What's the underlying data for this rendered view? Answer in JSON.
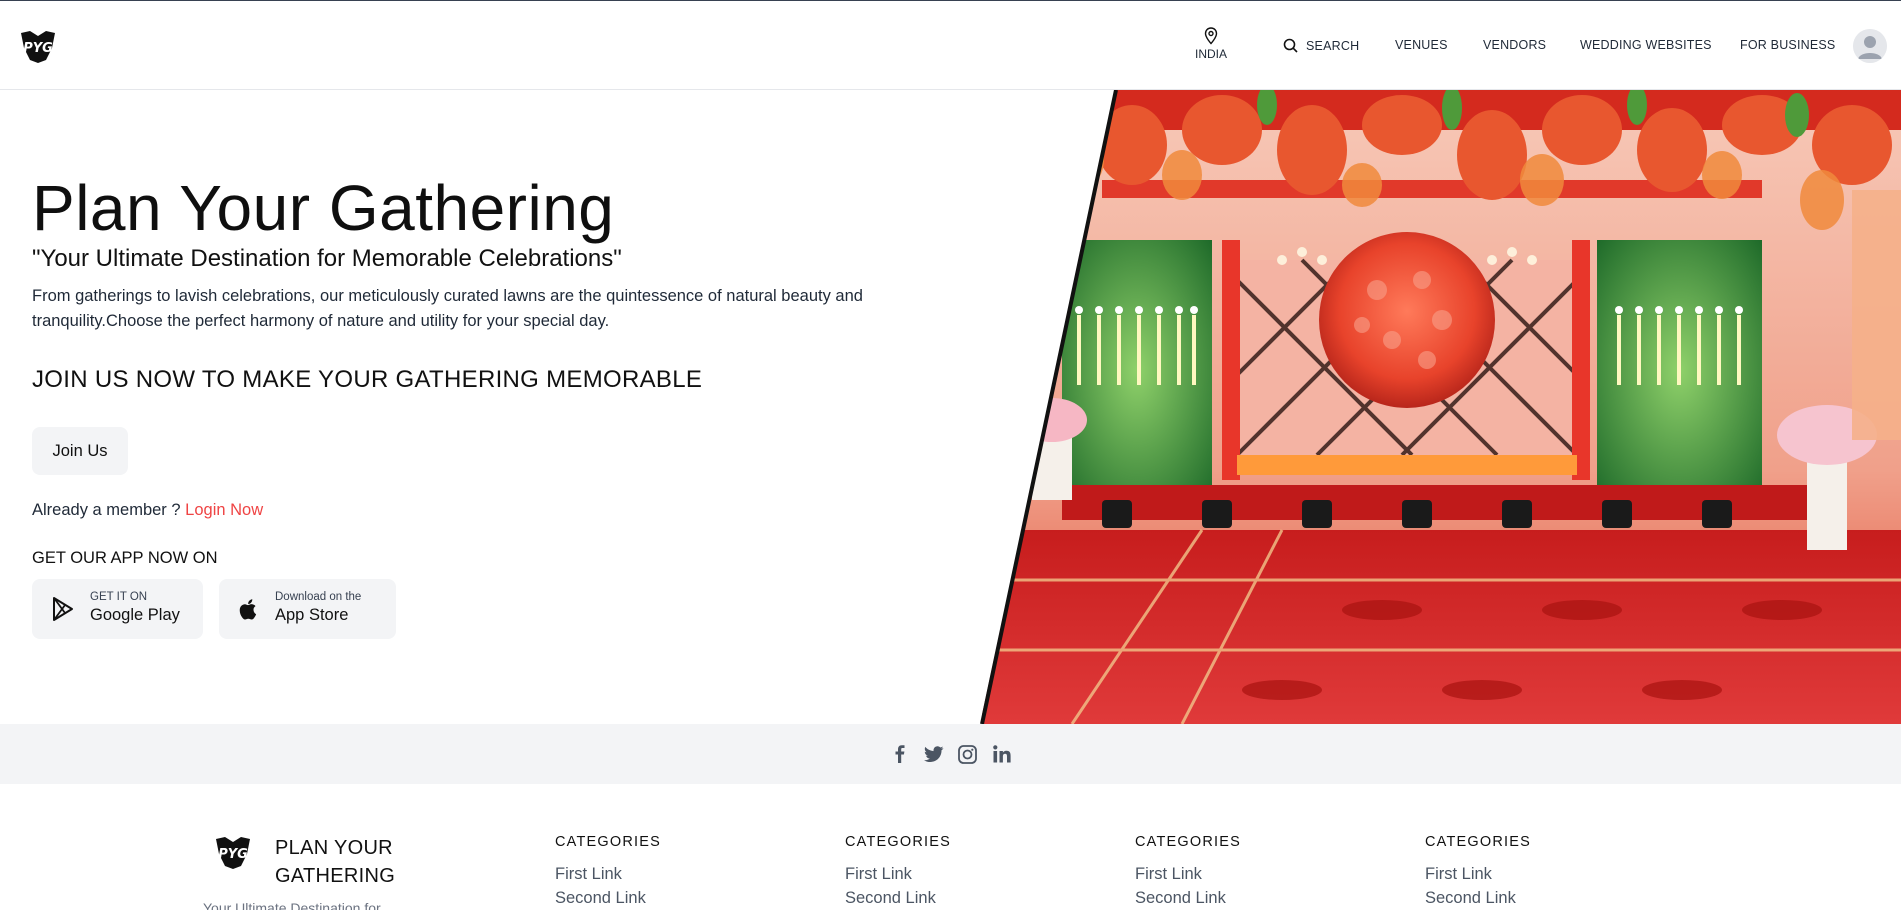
{
  "header": {
    "logo_text": "PYG",
    "location_label": "INDIA",
    "nav": [
      {
        "label": "SEARCH",
        "icon": "search-icon"
      },
      {
        "label": "VENUES"
      },
      {
        "label": "VENDORS"
      },
      {
        "label": "WEDDING WEBSITES"
      },
      {
        "label": "FOR BUSINESS"
      }
    ],
    "avatar_icon": "user-avatar-icon"
  },
  "hero": {
    "title": "Plan Your Gathering",
    "subtitle": "\"Your Ultimate Destination for Memorable Celebrations\"",
    "description": "From gatherings to lavish celebrations, our meticulously curated lawns are the quintessence of natural beauty and tranquility.Choose the perfect harmony of nature and utility for your special day.",
    "cta_heading": "JOIN US NOW TO MAKE YOUR GATHERING MEMORABLE",
    "join_button": "Join Us",
    "member_text": "Already a member ?",
    "login_link": "Login Now",
    "app_heading": "GET OUR APP NOW ON",
    "google_play": {
      "small": "GET IT ON",
      "big": "Google Play"
    },
    "app_store": {
      "small": "Download on the",
      "big": "App Store"
    },
    "image_description_icon": "venue-stage-photo"
  },
  "social": [
    "facebook-icon",
    "twitter-icon",
    "instagram-icon",
    "linkedin-icon"
  ],
  "footer": {
    "brand_line1": "PLAN YOUR",
    "brand_line2": "GATHERING",
    "tagline": "Your Ultimate Destination for",
    "columns": [
      {
        "heading": "CATEGORIES",
        "links": [
          "First Link",
          "Second Link"
        ]
      },
      {
        "heading": "CATEGORIES",
        "links": [
          "First Link",
          "Second Link"
        ]
      },
      {
        "heading": "CATEGORIES",
        "links": [
          "First Link",
          "Second Link"
        ]
      },
      {
        "heading": "CATEGORIES",
        "links": [
          "First Link",
          "Second Link"
        ]
      }
    ]
  },
  "colors": {
    "accent_link": "#ef4444",
    "button_bg": "#f3f4f6",
    "stage_red": "#d92b1f",
    "foliage_green": "#2e7d32"
  }
}
